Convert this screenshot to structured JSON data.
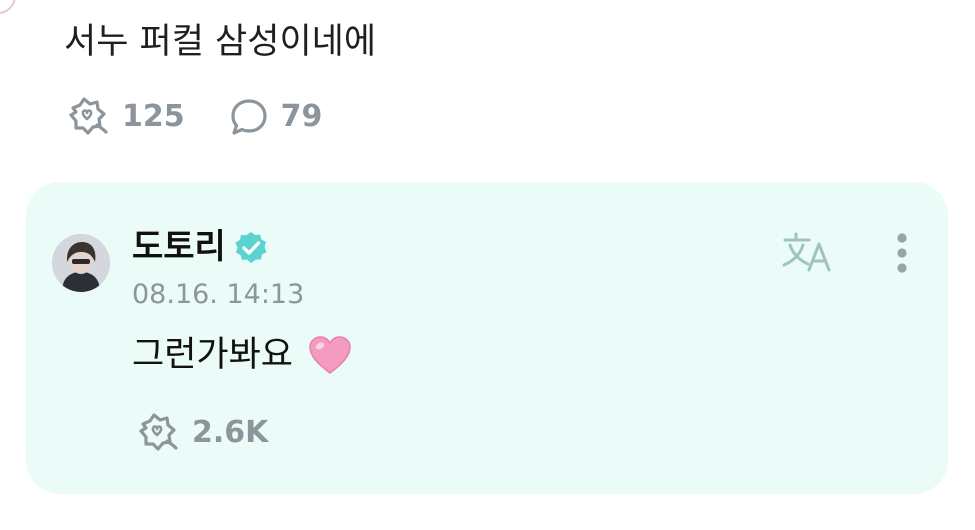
{
  "post": {
    "text": "서누 퍼컬 삼성이네에",
    "likes": "125",
    "comments": "79"
  },
  "reply": {
    "author": "도토리",
    "verified": true,
    "timestamp": "08.16. 14:13",
    "text": "그런가봐요",
    "emoji": "pink-heart",
    "likes": "2.6K"
  },
  "icons": {
    "like": "star-burst-like-icon",
    "comment": "speech-bubble-icon",
    "translate": "translate-icon",
    "more": "more-vertical-icon",
    "verified": "verified-badge-icon"
  },
  "colors": {
    "card_background": "#ebfbf7",
    "meta_text": "#8d959c",
    "verified": "#5ad3d1",
    "translate_icon": "#9fc3bd",
    "heart": "#f59ac1"
  }
}
